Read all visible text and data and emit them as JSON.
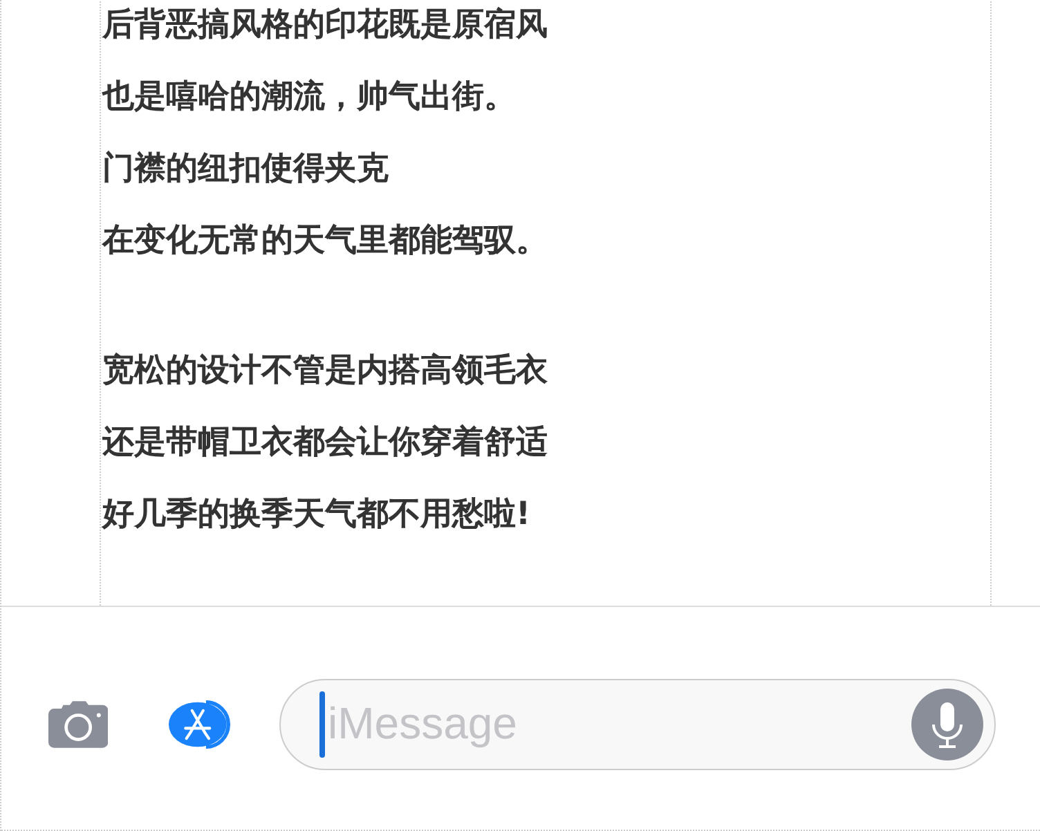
{
  "message_body": {
    "paragraphs": [
      {
        "lines": [
          "后背恶搞风格的印花既是原宿风",
          "也是嘻哈的潮流，帅气出街。",
          "门襟的纽扣使得夹克",
          "在变化无常的天气里都能驾驭。"
        ]
      },
      {
        "lines": [
          "宽松的设计不管是内搭高领毛衣",
          "还是带帽卫衣都会让你穿着舒适",
          "好几季的换季天气都不用愁啦!"
        ]
      }
    ]
  },
  "compose_bar": {
    "message_field": {
      "placeholder": "iMessage"
    }
  }
}
